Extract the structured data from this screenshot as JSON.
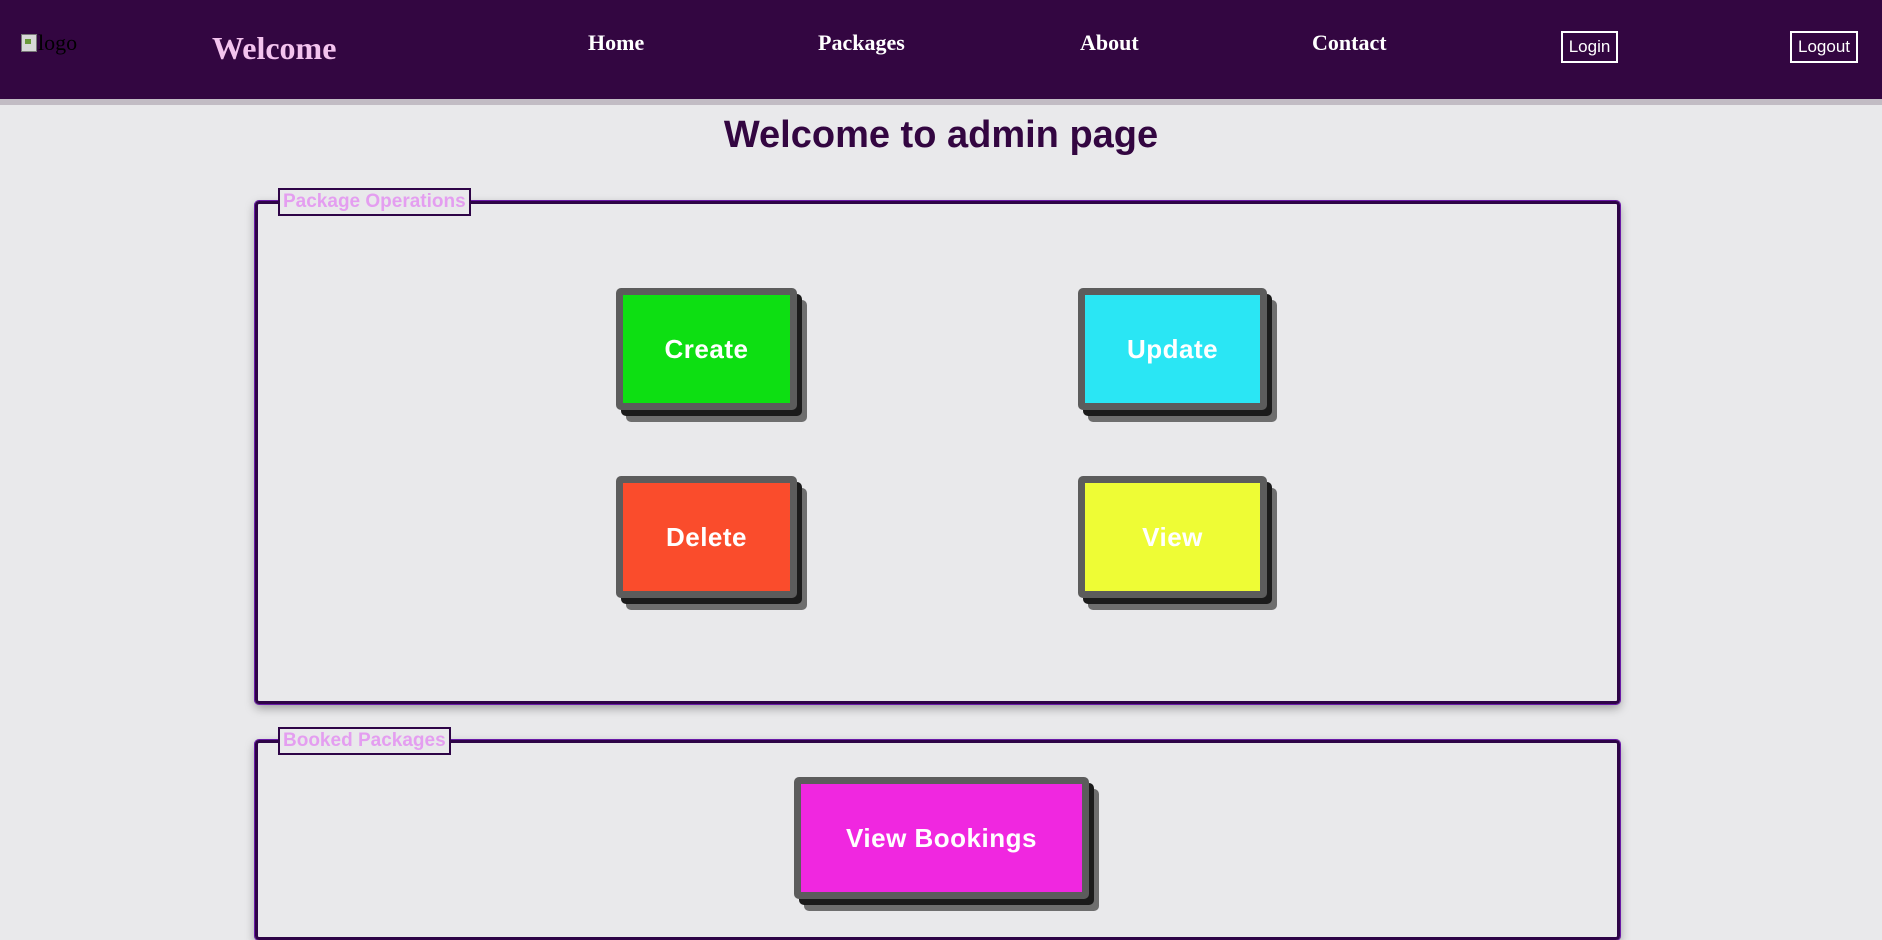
{
  "navbar": {
    "logo_alt": "logo",
    "brand": "Welcome",
    "links": [
      "Home",
      "Packages",
      "About",
      "Contact"
    ],
    "login_label": "Login",
    "logout_label": "Logout",
    "background_color": "#330641",
    "brand_color": "#f3c3ee"
  },
  "main": {
    "title": "Welcome to admin page",
    "title_color": "#330641"
  },
  "package_operations": {
    "legend": "Package Operations",
    "buttons": {
      "create": {
        "label": "Create",
        "color": "#0ddf12"
      },
      "update": {
        "label": "Update",
        "color": "#2ae6f4"
      },
      "delete": {
        "label": "Delete",
        "color": "#fa4c2c"
      },
      "view": {
        "label": "View",
        "color": "#eefc35"
      }
    }
  },
  "booked_packages": {
    "legend": "Booked Packages",
    "view_bookings": {
      "label": "View Bookings",
      "color": "#f027e0"
    }
  }
}
